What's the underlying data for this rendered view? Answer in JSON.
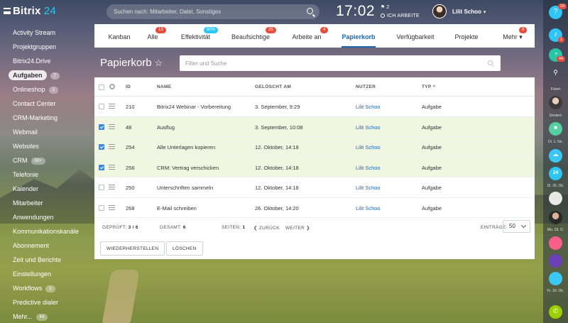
{
  "topbar": {
    "logo_text": "Bitrix",
    "logo_num": "24",
    "search_placeholder": "Suchen nach: Mitarbeiter, Datei, Sonstiges",
    "time": "17:02",
    "flag_count": "2",
    "work_status": "ICH ARBEITE",
    "user_name": "Lilit Schoo"
  },
  "sidebar": {
    "items": [
      {
        "label": "Activity Stream",
        "count": ""
      },
      {
        "label": "Projektgruppen",
        "count": ""
      },
      {
        "label": "Bitrix24.Drive",
        "count": ""
      },
      {
        "label": "Aufgaben",
        "count": "7"
      },
      {
        "label": "Onlineshop",
        "count": "1"
      },
      {
        "label": "Contact Center",
        "count": ""
      },
      {
        "label": "CRM-Marketing",
        "count": ""
      },
      {
        "label": "Webmail",
        "count": ""
      },
      {
        "label": "Websites",
        "count": ""
      },
      {
        "label": "CRM",
        "count": "50+"
      },
      {
        "label": "Telefonie",
        "count": ""
      },
      {
        "label": "Kalender",
        "count": ""
      },
      {
        "label": "Mitarbeiter",
        "count": ""
      },
      {
        "label": "Anwendungen",
        "count": ""
      },
      {
        "label": "Kommunikationskanäle",
        "count": ""
      },
      {
        "label": "Abonnement",
        "count": ""
      },
      {
        "label": "Zeit und Berichte",
        "count": ""
      },
      {
        "label": "Einstellungen",
        "count": ""
      },
      {
        "label": "Workflows",
        "count": "1"
      },
      {
        "label": "Predictive dialer",
        "count": ""
      },
      {
        "label": "Mehr...",
        "count": "44"
      }
    ]
  },
  "tabs": [
    {
      "label": "Kanban",
      "badge": ""
    },
    {
      "label": "Alle",
      "badge": "13"
    },
    {
      "label": "Effektivität",
      "badge": "90%"
    },
    {
      "label": "Beaufsichtige",
      "badge": "25"
    },
    {
      "label": "Arbeite an",
      "badge": "4"
    },
    {
      "label": "Papierkorb",
      "badge": ""
    },
    {
      "label": "Verfügbarkeit",
      "badge": ""
    },
    {
      "label": "Projekte",
      "badge": ""
    },
    {
      "label": "Mehr ▾",
      "badge": "9"
    }
  ],
  "page": {
    "title": "Papierkorb",
    "star": "☆",
    "filter_placeholder": "Filter und Suche"
  },
  "grid": {
    "headers": {
      "id": "ID",
      "name": "NAME",
      "deleted": "GELÖSCHT AM",
      "user": "NUTZER",
      "type": "TYP ^"
    },
    "rows": [
      {
        "checked": false,
        "id": "210",
        "name": "Bitrix24 Webinar - Vorbereitung",
        "deleted": "3. September, 9:29",
        "user": "Lilit Schoo",
        "type": "Aufgabe"
      },
      {
        "checked": true,
        "id": "48",
        "name": "Ausflug",
        "deleted": "3. September, 10:08",
        "user": "Lilit Schoo",
        "type": "Aufgabe"
      },
      {
        "checked": true,
        "id": "254",
        "name": "Alle Unterlagen kopieren",
        "deleted": "12. Oktober, 14:18",
        "user": "Lilit Schoo",
        "type": "Aufgabe"
      },
      {
        "checked": true,
        "id": "256",
        "name": "CRM: Vertrag verschicken",
        "deleted": "12. Oktober, 14:18",
        "user": "Lilit Schoo",
        "type": "Aufgabe"
      },
      {
        "checked": false,
        "id": "250",
        "name": "Unterschriften sammeln",
        "deleted": "12. Oktober, 14:18",
        "user": "Lilit Schoo",
        "type": "Aufgabe"
      },
      {
        "checked": false,
        "id": "268",
        "name": "E-Mail schreiben",
        "deleted": "26. Oktober, 14:20",
        "user": "Lilit Schoo",
        "type": "Aufgabe"
      }
    ],
    "footer": {
      "checked_label": "GEPRÜFT:",
      "checked_value": "3 / 6",
      "total_label": "GESAMT:",
      "total_value": "6",
      "pages_label": "SEITEN:",
      "pages_value": "1",
      "back": "❮ ZURÜCK",
      "next": "WEITER ❯",
      "per_page_label": "EINTRÄGE:",
      "per_page_value": "50"
    },
    "restore_button": "WIEDERHERSTELLEN",
    "delete_button": "LÖSCHEN"
  },
  "rail": {
    "help_badge": "10",
    "bell_badge": "1",
    "timer_badge": "44",
    "labels": [
      "Fixiert",
      "Gestern",
      "Di. 1. No.",
      "Di. 26. Ok.",
      "Mo. 18. O.",
      "Fr. 18. Ok."
    ]
  },
  "colors": {
    "accent": "#2067b0",
    "badge_red": "#e74c3c",
    "badge_blue": "#2fc6f6",
    "checked_row": "#f1f6e2"
  }
}
